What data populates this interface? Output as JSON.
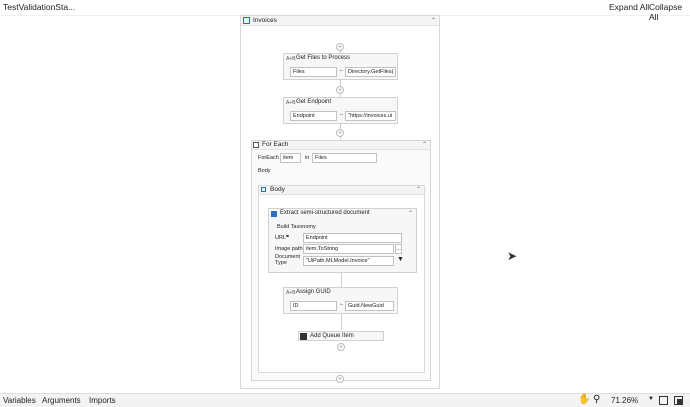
{
  "header": {
    "title": "TestValidationSta...",
    "expand_all": "Expand All",
    "collapse_all": "Collapse All"
  },
  "sequence": {
    "title": "Invoices",
    "get_files": {
      "title": "Get Files to Process",
      "var": "Files",
      "value": "Directory.GetFiles("
    },
    "get_endpoint": {
      "title": "Get Endpoint",
      "var": "Endpoint",
      "value": "\"https://invoices.ui"
    },
    "for_each": {
      "title": "For Each",
      "foreach_label": "ForEach",
      "item": "item",
      "in_label": "in",
      "collection": "Files",
      "body_label": "Body",
      "body": {
        "title": "Body",
        "extract": {
          "title": "Extract semi-structured document",
          "build_taxonomy": "Build Taxonomy",
          "url_label": "URL",
          "url_value": "Endpoint",
          "image_path_label": "Image path",
          "image_path_value": "item.ToString",
          "ellipsis": "...",
          "doc_type_label_1": "Document",
          "doc_type_label_2": "Type",
          "doc_type_value": "\"UiPath.MLModel.Invoice\""
        },
        "assign": {
          "title": "Assign GUID",
          "var": "ID",
          "value": "Guid.NewGuid"
        },
        "add_queue": {
          "title": "Add Queue Item"
        }
      }
    }
  },
  "statusbar": {
    "variables": "Variables",
    "arguments": "Arguments",
    "imports": "Imports",
    "zoom": "71.26%"
  }
}
